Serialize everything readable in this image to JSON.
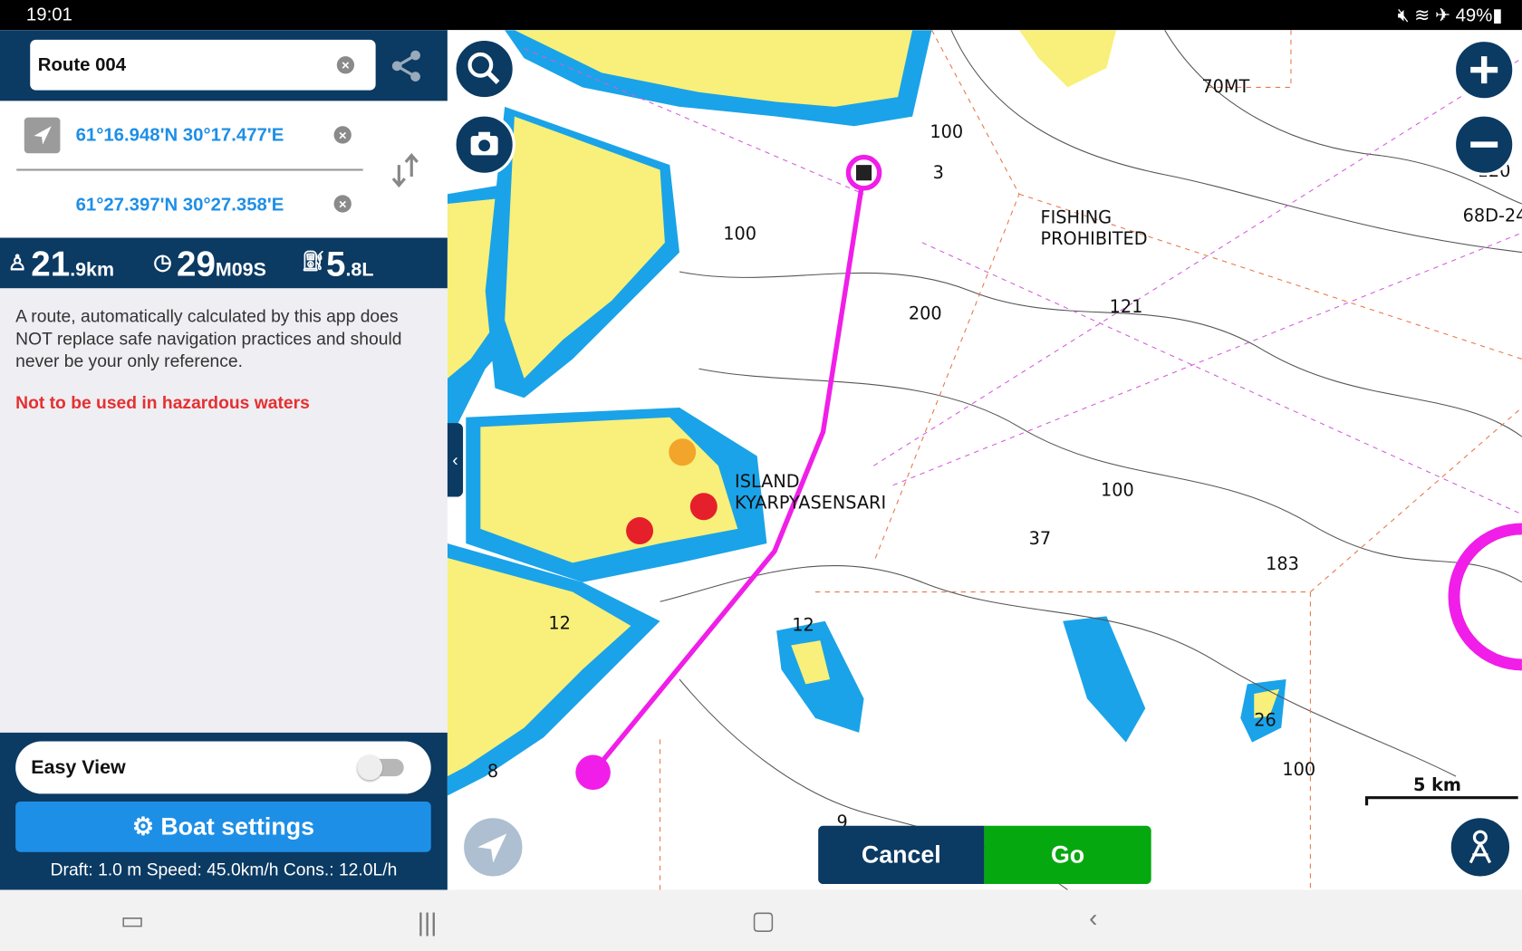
{
  "status_bar": {
    "time": "19:01",
    "battery": "49%",
    "icons": [
      "mute-icon",
      "wifi-icon",
      "airplane-icon",
      "battery-icon"
    ]
  },
  "route": {
    "name": "Route 004",
    "start": "61°16.948'N 30°17.477'E",
    "end": "61°27.397'N 30°27.358'E"
  },
  "stats": {
    "distance_main": "21",
    "distance_sub": ".9km",
    "time_main": "29",
    "time_sub": "M09S",
    "fuel_main": "5",
    "fuel_sub": ".8L"
  },
  "disclaimer": "A route, automatically calculated by this app does NOT replace safe navigation practices and should never be your only reference.",
  "warning": "Not to be used in hazardous waters",
  "easy_view": {
    "label": "Easy View",
    "on": false
  },
  "boat_settings": {
    "label": "Boat settings",
    "info": "Draft: 1.0 m Speed: 45.0km/h Cons.: 12.0L/h"
  },
  "map": {
    "labels": {
      "l1": "70MT",
      "l2": "100",
      "l3": "68D-24",
      "l4": "FISHING",
      "l5": "PROHIBITED",
      "l6": "121",
      "l7": "200",
      "l8": "100",
      "l9": "ISLAND",
      "l10": "KYARPYASENSARI",
      "l11": "100",
      "l12": "37",
      "l13": "183",
      "l14": "100",
      "l15": "8",
      "l16": "12",
      "l17": "12",
      "l18": "26",
      "l19": "3",
      "l20": "120",
      "l21": "9"
    },
    "scale": "5 km",
    "colors": {
      "land": "#f8f07a",
      "shallow": "#1aa3e8",
      "route": "#f01ee8",
      "navy": "#0b3a63",
      "go": "#06a80f"
    }
  },
  "actions": {
    "cancel": "Cancel",
    "go": "Go"
  }
}
